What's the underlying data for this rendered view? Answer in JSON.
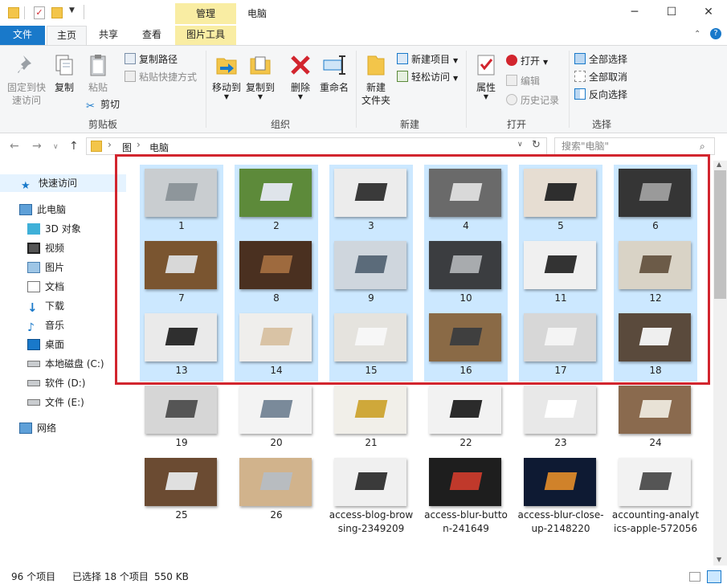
{
  "window": {
    "context_tab": "管理",
    "title": "电脑",
    "minimize": "─",
    "maximize": "☐",
    "close": "✕",
    "accent": "#1979ca"
  },
  "ribbon_tabs": {
    "file": "文件",
    "home": "主页",
    "share": "共享",
    "view": "查看",
    "picture_tools": "图片工具"
  },
  "ribbon": {
    "clipboard": {
      "pin": "固定到快\n速访问",
      "copy": "复制",
      "paste": "粘贴",
      "copy_path": "复制路径",
      "paste_shortcut": "粘贴快捷方式",
      "cut": "剪切",
      "label": "剪贴板"
    },
    "organize": {
      "move_to": "移动到",
      "copy_to": "复制到",
      "delete": "删除",
      "rename": "重命名",
      "label": "组织"
    },
    "new": {
      "new_folder": "新建\n文件夹",
      "new_item": "新建项目",
      "easy_access": "轻松访问",
      "label": "新建"
    },
    "open": {
      "properties": "属性",
      "open": "打开",
      "edit": "编辑",
      "history": "历史记录",
      "label": "打开"
    },
    "select": {
      "select_all": "全部选择",
      "select_none": "全部取消",
      "invert": "反向选择",
      "label": "选择"
    }
  },
  "address": {
    "path_root": "图",
    "path_current": "电脑",
    "search_placeholder": "搜索\"电脑\""
  },
  "nav": {
    "quick_access": "快速访问",
    "this_pc": "此电脑",
    "objects_3d": "3D 对象",
    "videos": "视频",
    "pictures": "图片",
    "documents": "文档",
    "downloads": "下载",
    "music": "音乐",
    "desktop": "桌面",
    "drive_c": "本地磁盘 (C:)",
    "drive_d": "软件 (D:)",
    "drive_e": "文件 (E:)",
    "network": "网络"
  },
  "files": [
    {
      "label": "1",
      "selected": true,
      "bg": "#c9cdd0",
      "fg": "#8e969b"
    },
    {
      "label": "2",
      "selected": true,
      "bg": "#5d8a3a",
      "fg": "#dfe4ea"
    },
    {
      "label": "3",
      "selected": true,
      "bg": "#ececec",
      "fg": "#3a3a3a"
    },
    {
      "label": "4",
      "selected": true,
      "bg": "#6a6a6a",
      "fg": "#d9d9d9"
    },
    {
      "label": "5",
      "selected": true,
      "bg": "#e6ddd2",
      "fg": "#2e2e2e"
    },
    {
      "label": "6",
      "selected": true,
      "bg": "#353535",
      "fg": "#9a9a9a"
    },
    {
      "label": "7",
      "selected": true,
      "bg": "#7a5530",
      "fg": "#d8d8d8"
    },
    {
      "label": "8",
      "selected": true,
      "bg": "#4a3020",
      "fg": "#9e6a3e"
    },
    {
      "label": "9",
      "selected": true,
      "bg": "#cfd6dd",
      "fg": "#5b6b7a"
    },
    {
      "label": "10",
      "selected": true,
      "bg": "#3b3d40",
      "fg": "#a8abae"
    },
    {
      "label": "11",
      "selected": true,
      "bg": "#f0f0f0",
      "fg": "#333333"
    },
    {
      "label": "12",
      "selected": true,
      "bg": "#d9d3c6",
      "fg": "#6c5b48"
    },
    {
      "label": "13",
      "selected": true,
      "bg": "#eaeaea",
      "fg": "#2f2f2f"
    },
    {
      "label": "14",
      "selected": true,
      "bg": "#efeeec",
      "fg": "#d9c3a5"
    },
    {
      "label": "15",
      "selected": true,
      "bg": "#e5e3de",
      "fg": "#f7f7f7"
    },
    {
      "label": "16",
      "selected": true,
      "bg": "#8a6a46",
      "fg": "#3f3f3f"
    },
    {
      "label": "17",
      "selected": true,
      "bg": "#d7d7d7",
      "fg": "#f4f4f4"
    },
    {
      "label": "18",
      "selected": true,
      "bg": "#5a4a3c",
      "fg": "#efefef"
    },
    {
      "label": "19",
      "selected": false,
      "bg": "#d6d6d6",
      "fg": "#555555"
    },
    {
      "label": "20",
      "selected": false,
      "bg": "#f3f3f3",
      "fg": "#7a8a9a"
    },
    {
      "label": "21",
      "selected": false,
      "bg": "#f1efe9",
      "fg": "#cfa83a"
    },
    {
      "label": "22",
      "selected": false,
      "bg": "#f2f2f2",
      "fg": "#2b2b2b"
    },
    {
      "label": "23",
      "selected": false,
      "bg": "#e8e8e8",
      "fg": "#ffffff"
    },
    {
      "label": "24",
      "selected": false,
      "bg": "#8a6a4e",
      "fg": "#e8e2d6"
    },
    {
      "label": "25",
      "selected": false,
      "bg": "#6b4b32",
      "fg": "#e0e0e0"
    },
    {
      "label": "26",
      "selected": false,
      "bg": "#d1b38c",
      "fg": "#b8bcc0"
    },
    {
      "label": "access-blog-browsing-2349209",
      "selected": false,
      "bg": "#f0f0f0",
      "fg": "#3a3a3a"
    },
    {
      "label": "access-blur-button-241649",
      "selected": false,
      "bg": "#1e1e1e",
      "fg": "#c0392b"
    },
    {
      "label": "access-blur-close-up-2148220",
      "selected": false,
      "bg": "#0e1a33",
      "fg": "#d0822a"
    },
    {
      "label": "accounting-analytics-apple-572056",
      "selected": false,
      "bg": "#f2f2f2",
      "fg": "#555555"
    }
  ],
  "status": {
    "count": "96 个项目",
    "selected": "已选择 18 个项目",
    "size": "550 KB"
  }
}
